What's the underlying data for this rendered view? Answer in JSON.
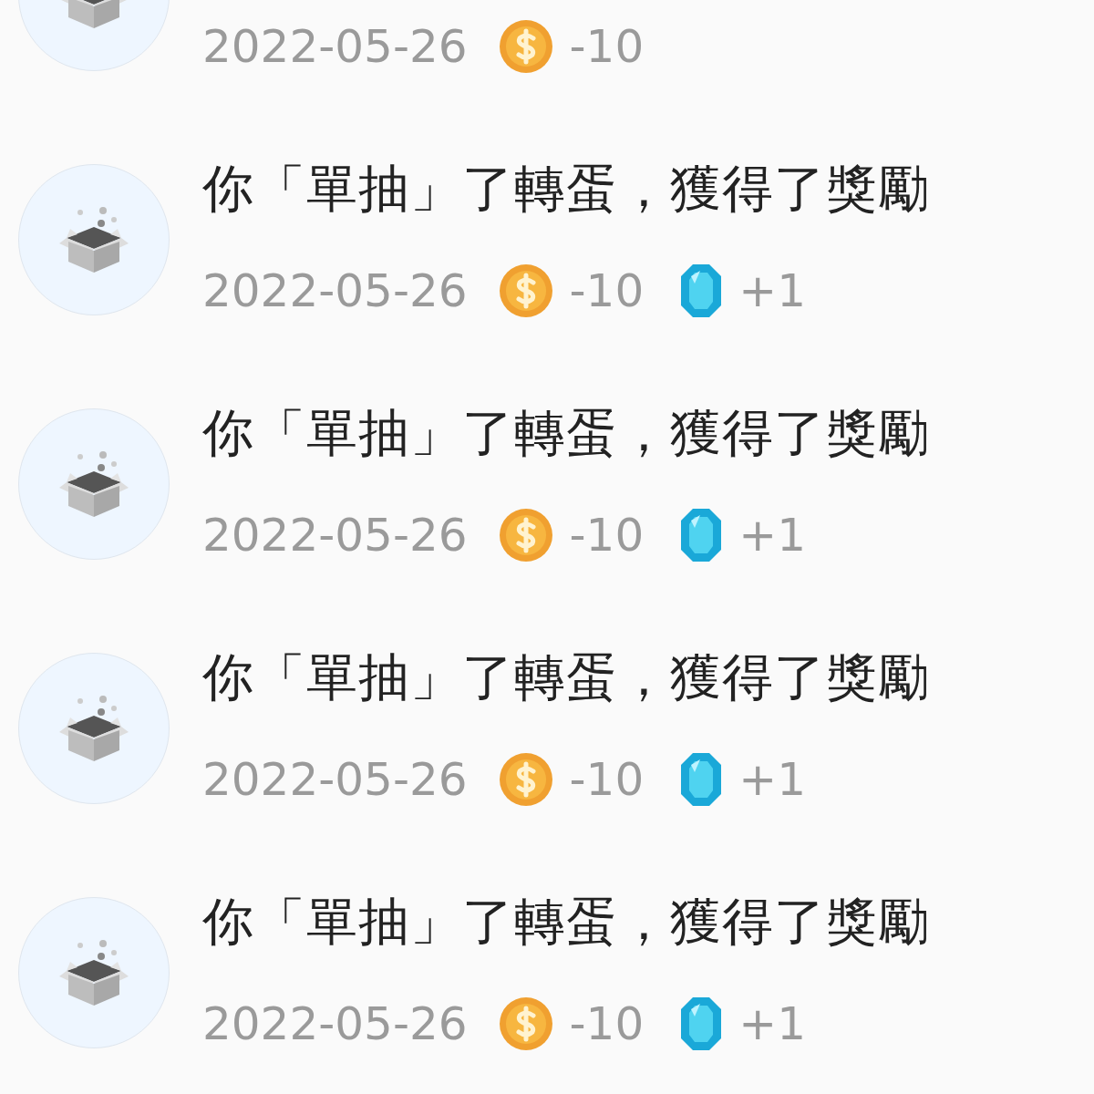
{
  "records": [
    {
      "date": "2022-05-26",
      "rewards": [
        {
          "kind": "coin",
          "amount": "-10"
        }
      ]
    },
    {
      "title": "你「單抽」了轉蛋，獲得了獎勵",
      "date": "2022-05-26",
      "rewards": [
        {
          "kind": "coin",
          "amount": "-10"
        },
        {
          "kind": "gem",
          "amount": "+1"
        }
      ]
    },
    {
      "title": "你「單抽」了轉蛋，獲得了獎勵",
      "date": "2022-05-26",
      "rewards": [
        {
          "kind": "coin",
          "amount": "-10"
        },
        {
          "kind": "gem",
          "amount": "+1"
        }
      ]
    },
    {
      "title": "你「單抽」了轉蛋，獲得了獎勵",
      "date": "2022-05-26",
      "rewards": [
        {
          "kind": "coin",
          "amount": "-10"
        },
        {
          "kind": "gem",
          "amount": "+1"
        }
      ]
    },
    {
      "title": "你「單抽」了轉蛋，獲得了獎勵",
      "date": "2022-05-26",
      "rewards": [
        {
          "kind": "coin",
          "amount": "-10"
        },
        {
          "kind": "gem",
          "amount": "+1"
        }
      ]
    }
  ]
}
